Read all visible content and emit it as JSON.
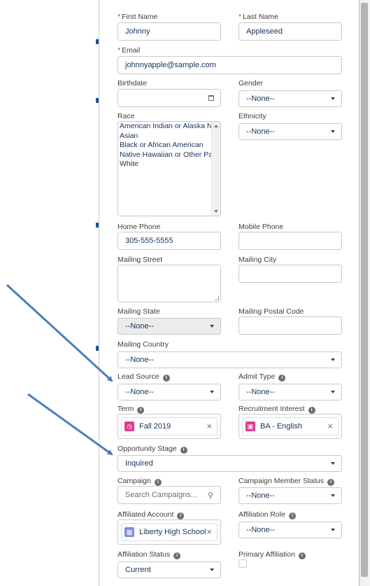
{
  "form": {
    "first_name": {
      "label": "First Name",
      "required_mark": "*",
      "value": "Johnny"
    },
    "last_name": {
      "label": "Last Name",
      "required_mark": "*",
      "value": "Appleseed"
    },
    "email": {
      "label": "Email",
      "required_mark": "*",
      "value": "johnnyapple@sample.com"
    },
    "birthdate": {
      "label": "Birthdate",
      "value": "",
      "icon": "calendar-icon"
    },
    "gender": {
      "label": "Gender",
      "value": "--None--"
    },
    "race": {
      "label": "Race",
      "options": [
        "American Indian or Alaska Na",
        "Asian",
        "Black or African American",
        "Native Hawaiian or Other Pac",
        "White"
      ]
    },
    "ethnicity": {
      "label": "Ethnicity",
      "value": "--None--"
    },
    "home_phone": {
      "label": "Home Phone",
      "value": "305-555-5555"
    },
    "mobile_phone": {
      "label": "Mobile Phone",
      "value": ""
    },
    "mailing_street": {
      "label": "Mailing Street",
      "value": ""
    },
    "mailing_city": {
      "label": "Mailing City",
      "value": ""
    },
    "mailing_state": {
      "label": "Mailing State",
      "value": "--None--"
    },
    "mailing_postal_code": {
      "label": "Mailing Postal Code",
      "value": ""
    },
    "mailing_country": {
      "label": "Mailing Country",
      "value": "--None--"
    },
    "lead_source": {
      "label": "Lead Source",
      "value": "--None--"
    },
    "admit_type": {
      "label": "Admit Type",
      "value": "--None--"
    },
    "term": {
      "label": "Term",
      "value": "Fall 2019",
      "icon": "clock-icon",
      "icon_color": "#e3398f"
    },
    "recruitment_interest": {
      "label": "Recruitment Interest",
      "value": "BA - English",
      "icon": "box-icon",
      "icon_color": "#e3398f"
    },
    "opportunity_stage": {
      "label": "Opportunity Stage",
      "value": "Inquired"
    },
    "campaign": {
      "label": "Campaign",
      "placeholder": "Search Campaigns..."
    },
    "campaign_member_status": {
      "label": "Campaign Member Status",
      "value": "--None--"
    },
    "affiliated_account": {
      "label": "Affiliated Account",
      "value": "Liberty High School",
      "icon": "building-icon",
      "icon_color": "#7f8de1"
    },
    "affiliation_role": {
      "label": "Affiliation Role",
      "value": "--None--"
    },
    "affiliation_status": {
      "label": "Affiliation Status",
      "value": "Current"
    },
    "primary_affiliation": {
      "label": "Primary Affiliation",
      "checked": false
    }
  },
  "colors": {
    "required": "#c23934",
    "annotation_arrow": "#4a7ebb",
    "input_text": "#16325c"
  }
}
